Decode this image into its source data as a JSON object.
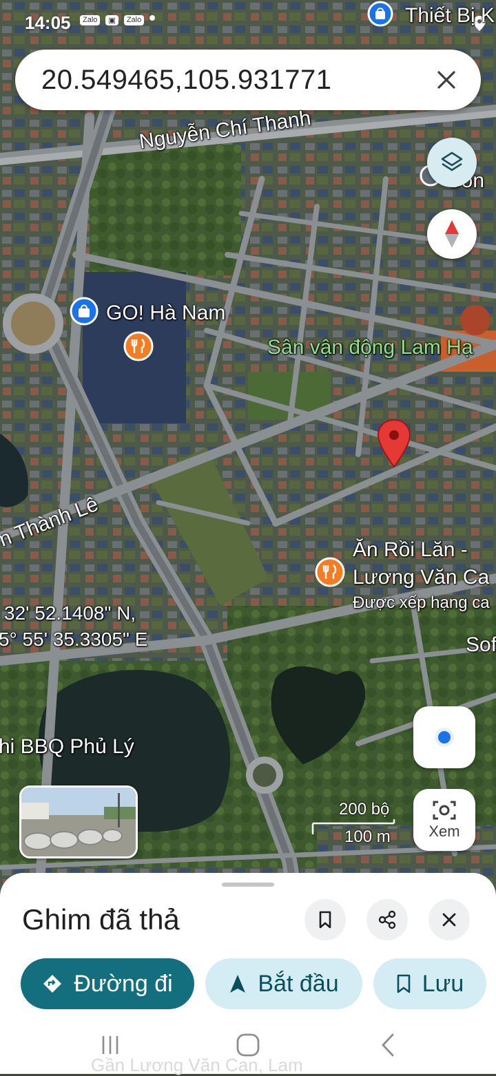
{
  "status_bar": {
    "time": "14:05",
    "app_icons": [
      "Zalo",
      "Zalo"
    ]
  },
  "search": {
    "value": "20.549465,105.931771"
  },
  "map": {
    "roads": [
      "Nguyễn Chí Thanh",
      "n Thành Lê"
    ],
    "pois": [
      {
        "name": "GO! Hà Nam",
        "icon": "shopping-bag-icon"
      },
      {
        "name": "Thiết Bị K",
        "icon": "shopping-bag-icon"
      },
      {
        "name": "Côn",
        "icon": "place-icon"
      },
      {
        "name": "Ăn Rồi Lăn -",
        "name2": "Lương Văn Ca",
        "sub": "Được xếp hạng ca",
        "icon": "restaurant-icon"
      },
      {
        "name": "hi BBQ Phủ Lý"
      },
      {
        "name": "Sof"
      }
    ],
    "green_label": "Sân vận động Lam Hạ",
    "coords": [
      "32' 52.1408\" N,",
      "5° 55' 35.3305\" E"
    ],
    "scale": {
      "imperial": "200 bộ",
      "metric": "100 m"
    },
    "lens_label": "Xem",
    "colors": {
      "pin": "#e53935",
      "accent": "#136f7e",
      "chip_bg": "#d4ecf4"
    }
  },
  "sheet": {
    "title": "Ghim đã thả",
    "buttons": {
      "directions": "Đường đi",
      "start": "Bắt đầu",
      "save": "Lưu"
    },
    "ghost_text": "Gần Lương Văn Can, Lam"
  }
}
